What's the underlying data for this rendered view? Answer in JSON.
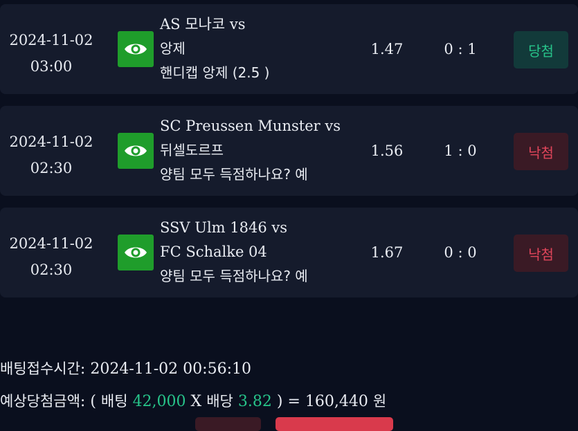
{
  "bets": [
    {
      "date": "2024-11-02",
      "time": "03:00",
      "match_line1": "AS 모나코 vs",
      "match_line2": "앙제",
      "pick": "핸디캡 앙제 (2.5 )",
      "odds": "1.47",
      "score": "0 : 1",
      "result": "당첨",
      "result_type": "win"
    },
    {
      "date": "2024-11-02",
      "time": "02:30",
      "match_line1": "SC Preussen Munster vs",
      "match_line2": "뒤셀도르프",
      "pick": "양팀 모두 득점하나요? 예",
      "odds": "1.56",
      "score": "1 : 0",
      "result": "낙첨",
      "result_type": "lose"
    },
    {
      "date": "2024-11-02",
      "time": "02:30",
      "match_line1": "SSV Ulm 1846 vs",
      "match_line2": "FC Schalke 04",
      "pick": "양팀 모두 득점하나요? 예",
      "odds": "1.67",
      "score": "0 : 0",
      "result": "낙첨",
      "result_type": "lose"
    }
  ],
  "summary": {
    "time_label": "배팅접수시간",
    "time_value": "2024-11-02 00:56:10",
    "expected_label": "예상당첨금액",
    "open_paren": "(",
    "bet_label": "배팅",
    "bet_amount": "42,000",
    "times": "X",
    "odds_label": "배당",
    "total_odds": "3.82",
    "close_paren": ")",
    "equals": "=",
    "payout": "160,440",
    "currency": "원"
  },
  "colors": {
    "background": "#0a0f1e",
    "row_background": "#151b2c",
    "eye_button": "#1f9d2b",
    "win": "#27c48a",
    "lose": "#e0455a"
  },
  "icons": {
    "view": "eye-icon"
  }
}
